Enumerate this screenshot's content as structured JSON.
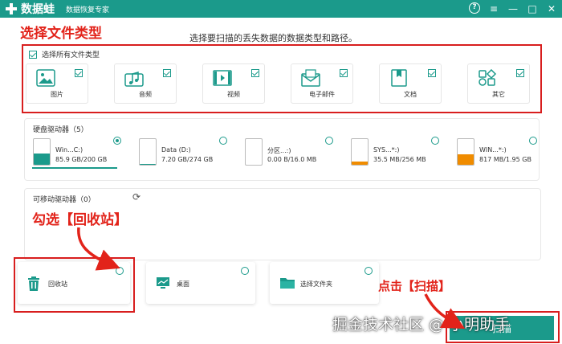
{
  "titlebar": {
    "app_name": "数据蛙",
    "subtitle": "数据恢复专家",
    "help": "?",
    "menu": "≡",
    "minimize": "—",
    "maximize": "□",
    "close": "✕"
  },
  "annotations": {
    "select_type": "选择文件类型",
    "check_recycle": "勾选【回收站】",
    "click_scan": "点击【扫描】"
  },
  "instruction": "选择要扫描的丢失数据的数据类型和路径。",
  "file_types": {
    "select_all_label": "选择所有文件类型",
    "select_all_checked": true,
    "items": [
      {
        "label": "图片",
        "icon": "image-icon",
        "checked": true
      },
      {
        "label": "音频",
        "icon": "audio-icon",
        "checked": true
      },
      {
        "label": "视频",
        "icon": "video-icon",
        "checked": true
      },
      {
        "label": "电子邮件",
        "icon": "email-icon",
        "checked": true
      },
      {
        "label": "文档",
        "icon": "document-icon",
        "checked": true
      },
      {
        "label": "其它",
        "icon": "other-icon",
        "checked": true
      }
    ]
  },
  "hard_drives": {
    "title": "硬盘驱动器（5）",
    "items": [
      {
        "name": "Win...C:)",
        "size": "85.9 GB/200 GB",
        "used": 0.43,
        "color": "#1b9a8b",
        "selected": true
      },
      {
        "name": "Data (D:)",
        "size": "7.20 GB/274 GB",
        "used": 0.03,
        "color": "#1b9a8b",
        "selected": false
      },
      {
        "name": "分区...:)",
        "size": "0.00  B/16.0 MB",
        "used": 0.0,
        "color": "#1b9a8b",
        "selected": false
      },
      {
        "name": "SYS...*:)",
        "size": "35.5 MB/256 MB",
        "used": 0.14,
        "color": "#f08c00",
        "selected": false
      },
      {
        "name": "WIN...*:)",
        "size": "817 MB/1.95 GB",
        "used": 0.42,
        "color": "#f08c00",
        "selected": false
      }
    ]
  },
  "removable": {
    "title": "可移动驱动器（0）",
    "refresh_icon": "refresh-icon"
  },
  "locations": [
    {
      "label": "回收站",
      "icon": "trash-icon",
      "selected": false
    },
    {
      "label": "桌面",
      "icon": "desktop-icon",
      "selected": false
    },
    {
      "label": "选择文件夹",
      "icon": "folder-icon",
      "selected": false
    }
  ],
  "watermark": "掘金技术社区 @ 小明助手",
  "scan_button": "扫描",
  "colors": {
    "accent": "#1b9a8b",
    "annotation": "#e2231a",
    "warning": "#f08c00"
  }
}
